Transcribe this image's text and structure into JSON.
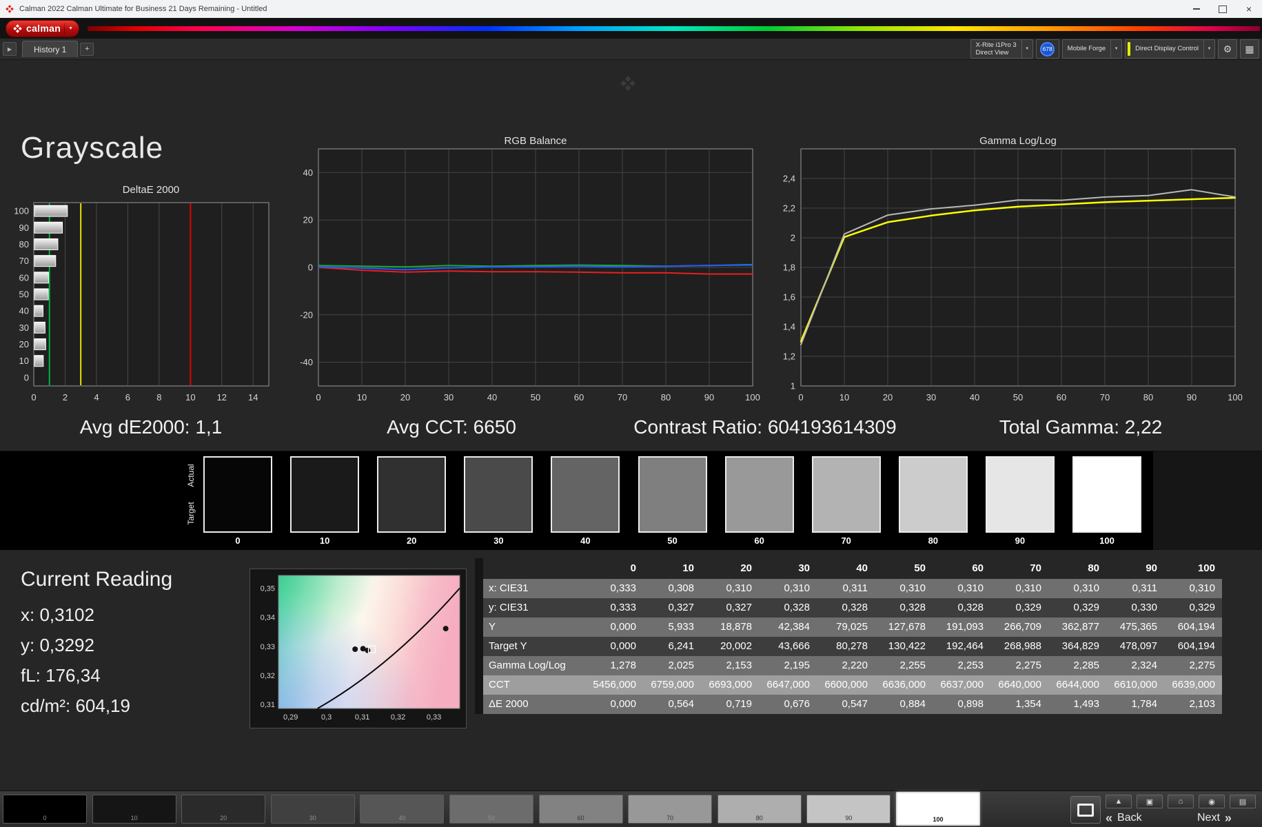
{
  "window": {
    "title": "Calman 2022 Calman Ultimate for Business 21 Days Remaining  - Untitled"
  },
  "brand": {
    "name": "calman"
  },
  "icons": {
    "close": "×",
    "dropdown": "▼",
    "flyout": "▶",
    "gear": "⚙",
    "layout": "▦",
    "chevrons_left": "«",
    "chevrons_right": "»",
    "tools": [
      "▲",
      "▣",
      "⌂",
      "◉",
      "▤"
    ]
  },
  "tabs": {
    "history": "History 1",
    "add": "+"
  },
  "meters": {
    "meter1_line1": "X-Rite i1Pro 3",
    "meter1_line2": "Direct View",
    "badge": "678",
    "meter2": "Mobile Forge",
    "meter3": "Direct Display Control"
  },
  "page": {
    "heading": "Grayscale"
  },
  "stats": [
    "Avg dE2000: 1,1",
    "Avg CCT: 6650",
    "Contrast Ratio: 604193614309",
    "Total Gamma: 2,22"
  ],
  "strip": {
    "row_labels": [
      "Actual",
      "Target"
    ],
    "levels": [
      {
        "label": "0",
        "color": "#060606"
      },
      {
        "label": "10",
        "color": "#1a1a1a"
      },
      {
        "label": "20",
        "color": "#303030"
      },
      {
        "label": "30",
        "color": "#4a4a4a"
      },
      {
        "label": "40",
        "color": "#646464"
      },
      {
        "label": "50",
        "color": "#7f7f7f"
      },
      {
        "label": "60",
        "color": "#999999"
      },
      {
        "label": "70",
        "color": "#b3b3b3"
      },
      {
        "label": "80",
        "color": "#cccccc"
      },
      {
        "label": "90",
        "color": "#e6e6e6"
      },
      {
        "label": "100",
        "color": "#ffffff"
      }
    ]
  },
  "current_reading": {
    "heading": "Current Reading",
    "lines": [
      "x: 0,3102",
      "y: 0,3292",
      "fL: 176,34",
      "cd/m²: 604,19"
    ]
  },
  "table": {
    "columns": [
      "0",
      "10",
      "20",
      "30",
      "40",
      "50",
      "60",
      "70",
      "80",
      "90",
      "100"
    ],
    "rows": [
      {
        "label": "x: CIE31",
        "values": [
          "0,333",
          "0,308",
          "0,310",
          "0,310",
          "0,311",
          "0,310",
          "0,310",
          "0,310",
          "0,310",
          "0,311",
          "0,310"
        ]
      },
      {
        "label": "y: CIE31",
        "values": [
          "0,333",
          "0,327",
          "0,327",
          "0,328",
          "0,328",
          "0,328",
          "0,328",
          "0,329",
          "0,329",
          "0,330",
          "0,329"
        ]
      },
      {
        "label": "Y",
        "values": [
          "0,000",
          "5,933",
          "18,878",
          "42,384",
          "79,025",
          "127,678",
          "191,093",
          "266,709",
          "362,877",
          "475,365",
          "604,194"
        ]
      },
      {
        "label": "Target Y",
        "values": [
          "0,000",
          "6,241",
          "20,002",
          "43,666",
          "80,278",
          "130,422",
          "192,464",
          "268,988",
          "364,829",
          "478,097",
          "604,194"
        ]
      },
      {
        "label": "Gamma Log/Log",
        "values": [
          "1,278",
          "2,025",
          "2,153",
          "2,195",
          "2,220",
          "2,255",
          "2,253",
          "2,275",
          "2,285",
          "2,324",
          "2,275"
        ]
      },
      {
        "label": "CCT",
        "values": [
          "5456,000",
          "6759,000",
          "6693,000",
          "6647,000",
          "6600,000",
          "6636,000",
          "6637,000",
          "6640,000",
          "6644,000",
          "6610,000",
          "6639,000"
        ]
      },
      {
        "label": "ΔE 2000",
        "values": [
          "0,000",
          "0,564",
          "0,719",
          "0,676",
          "0,547",
          "0,884",
          "0,898",
          "1,354",
          "1,493",
          "1,784",
          "2,103"
        ]
      }
    ]
  },
  "bottom": {
    "back": "Back",
    "next": "Next",
    "patches": [
      {
        "label": "0",
        "color": "#000000"
      },
      {
        "label": "10",
        "color": "#151515"
      },
      {
        "label": "20",
        "color": "#2a2a2a"
      },
      {
        "label": "30",
        "color": "#404040"
      },
      {
        "label": "40",
        "color": "#565656"
      },
      {
        "label": "50",
        "color": "#6c6c6c"
      },
      {
        "label": "60",
        "color": "#828282"
      },
      {
        "label": "70",
        "color": "#989898"
      },
      {
        "label": "80",
        "color": "#aeaeae"
      },
      {
        "label": "90",
        "color": "#c4c4c4"
      },
      {
        "label": "100",
        "color": "#ffffff",
        "selected": true
      }
    ]
  },
  "chart_data": [
    {
      "type": "bar",
      "orientation": "horizontal",
      "title": "DeltaE 2000",
      "categories": [
        "100",
        "90",
        "80",
        "70",
        "60",
        "50",
        "40",
        "30",
        "20",
        "10",
        "0"
      ],
      "values": [
        2.103,
        1.784,
        1.493,
        1.354,
        0.898,
        0.884,
        0.547,
        0.676,
        0.719,
        0.564,
        0
      ],
      "xlim": [
        0,
        15
      ],
      "xticks": [
        0,
        2,
        4,
        6,
        8,
        10,
        12,
        14
      ],
      "grid_x": [
        2,
        4,
        6,
        8,
        12,
        14
      ],
      "reference_lines": [
        {
          "x": 1,
          "color": "#00b43c"
        },
        {
          "x": 3,
          "color": "#e6e600"
        },
        {
          "x": 10,
          "color": "#e60000"
        }
      ]
    },
    {
      "type": "line",
      "title": "RGB Balance",
      "x": [
        0,
        10,
        20,
        30,
        40,
        50,
        60,
        70,
        80,
        90,
        100
      ],
      "xlim": [
        0,
        100
      ],
      "ylim": [
        -50,
        50
      ],
      "xticks": [
        0,
        10,
        20,
        30,
        40,
        50,
        60,
        70,
        80,
        90,
        100
      ],
      "yticks": [
        {
          "v": 40,
          "l": "40"
        },
        {
          "v": 20,
          "l": "20"
        },
        {
          "v": 0,
          "l": "0"
        },
        {
          "v": -20,
          "l": "-20"
        },
        {
          "v": -40,
          "l": "-40"
        }
      ],
      "series": [
        {
          "name": "Red",
          "color": "#e62020",
          "values": [
            0,
            -1.2,
            -2,
            -1.5,
            -1.8,
            -1.8,
            -2,
            -2.3,
            -2.3,
            -2.8,
            -2.8
          ]
        },
        {
          "name": "Green",
          "color": "#18a838",
          "values": [
            0.8,
            0.5,
            0.2,
            0.8,
            0.5,
            0.8,
            1,
            0.8,
            0.5,
            0.8,
            1.2
          ]
        },
        {
          "name": "Blue",
          "color": "#2858ff",
          "values": [
            0.2,
            -0.3,
            -1,
            -0.2,
            0.2,
            0.3,
            0.5,
            0.2,
            0.5,
            0.8,
            1
          ]
        }
      ]
    },
    {
      "type": "line",
      "title": "Gamma Log/Log",
      "x": [
        0,
        10,
        20,
        30,
        40,
        50,
        60,
        70,
        80,
        90,
        100
      ],
      "xlim": [
        0,
        100
      ],
      "ylim": [
        1,
        2.6
      ],
      "xticks": [
        0,
        10,
        20,
        30,
        40,
        50,
        60,
        70,
        80,
        90,
        100
      ],
      "yticks": [
        {
          "v": 2.4,
          "l": "2,4"
        },
        {
          "v": 2.2,
          "l": "2,2"
        },
        {
          "v": 2,
          "l": "2"
        },
        {
          "v": 1.8,
          "l": "1,8"
        },
        {
          "v": 1.6,
          "l": "1,6"
        },
        {
          "v": 1.4,
          "l": "1,4"
        },
        {
          "v": 1.2,
          "l": "1,2"
        },
        {
          "v": 1,
          "l": "1"
        }
      ],
      "series": [
        {
          "name": "Target Gamma",
          "color": "#ffff00",
          "width": 2.5,
          "values": [
            1.3,
            2.005,
            2.105,
            2.15,
            2.185,
            2.21,
            2.225,
            2.24,
            2.25,
            2.26,
            2.27
          ]
        },
        {
          "name": "Measured Gamma",
          "color": "#b8b8b8",
          "width": 2,
          "values": [
            1.278,
            2.025,
            2.153,
            2.195,
            2.22,
            2.255,
            2.253,
            2.275,
            2.285,
            2.324,
            2.275
          ]
        }
      ]
    },
    {
      "type": "scatter",
      "title": "CIE Chromaticity",
      "xlim": [
        0.2866,
        0.3372
      ],
      "ylim": [
        0.3086,
        0.3544
      ],
      "xticks": [
        {
          "v": 0.29,
          "l": "0,29"
        },
        {
          "v": 0.3,
          "l": "0,3"
        },
        {
          "v": 0.31,
          "l": "0,31"
        },
        {
          "v": 0.32,
          "l": "0,32"
        },
        {
          "v": 0.33,
          "l": "0,33"
        }
      ],
      "yticks": [
        {
          "v": 0.35,
          "l": "0,35"
        },
        {
          "v": 0.34,
          "l": "0,34"
        },
        {
          "v": 0.33,
          "l": "0,33"
        },
        {
          "v": 0.32,
          "l": "0,32"
        },
        {
          "v": 0.31,
          "l": "0,31"
        }
      ],
      "locus": [
        [
          0.2975,
          0.3086
        ],
        [
          0.318,
          0.323
        ],
        [
          0.3372,
          0.35
        ]
      ],
      "points": [
        [
          0.308,
          0.329
        ],
        [
          0.3102,
          0.3292
        ],
        [
          0.3115,
          0.3286
        ],
        [
          0.3333,
          0.3361
        ]
      ],
      "target": [
        0.3127,
        0.329
      ]
    }
  ]
}
